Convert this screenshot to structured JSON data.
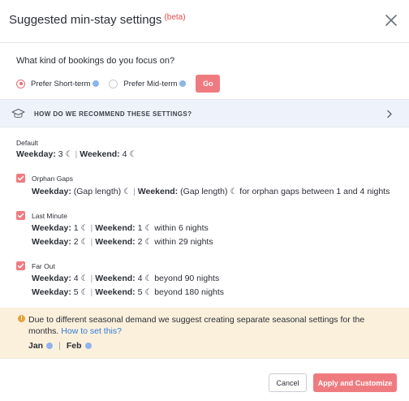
{
  "dialog": {
    "title": "Suggested min-stay settings",
    "beta": "(beta)"
  },
  "focus": {
    "question": "What kind of bookings do you focus on?",
    "options": [
      {
        "label": "Prefer Short-term",
        "selected": true
      },
      {
        "label": "Prefer Mid-term",
        "selected": false
      }
    ],
    "go_label": "Go"
  },
  "how": {
    "label": "HOW DO WE RECOMMEND THESE SETTINGS?"
  },
  "default": {
    "label": "Default",
    "weekday_label": "Weekday:",
    "weekday_value": "3",
    "weekend_label": "Weekend:",
    "weekend_value": "4"
  },
  "orphan": {
    "label": "Orphan Gaps",
    "checked": true,
    "weekday_label": "Weekday:",
    "weekday_value": "(Gap length)",
    "weekend_label": "Weekend:",
    "weekend_value": "(Gap length)",
    "suffix": "for orphan gaps between 1 and 4 nights"
  },
  "last_minute": {
    "label": "Last Minute",
    "checked": true,
    "rows": [
      {
        "weekday_label": "Weekday:",
        "weekday_value": "1",
        "weekend_label": "Weekend:",
        "weekend_value": "1",
        "suffix": "within 6 nights"
      },
      {
        "weekday_label": "Weekday:",
        "weekday_value": "2",
        "weekend_label": "Weekend:",
        "weekend_value": "2",
        "suffix": "within 29 nights"
      }
    ]
  },
  "far_out": {
    "label": "Far Out",
    "checked": true,
    "rows": [
      {
        "weekday_label": "Weekday:",
        "weekday_value": "4",
        "weekend_label": "Weekend:",
        "weekend_value": "4",
        "suffix": "beyond 90 nights"
      },
      {
        "weekday_label": "Weekday:",
        "weekday_value": "5",
        "weekend_label": "Weekend:",
        "weekend_value": "5",
        "suffix": "beyond 180 nights"
      }
    ]
  },
  "notice": {
    "text": "Due to different seasonal demand we suggest creating separate seasonal settings for the months.",
    "link": "How to set this?",
    "months": [
      "Jan",
      "Feb"
    ]
  },
  "footer": {
    "cancel": "Cancel",
    "apply": "Apply and Customize"
  },
  "colors": {
    "accent": "#ef7b80",
    "link": "#2f7bd8",
    "notice_bg": "#fbf0dc",
    "info_bar_bg": "#eef3fb"
  },
  "icons": {
    "moon": "☾",
    "separator": "|"
  }
}
